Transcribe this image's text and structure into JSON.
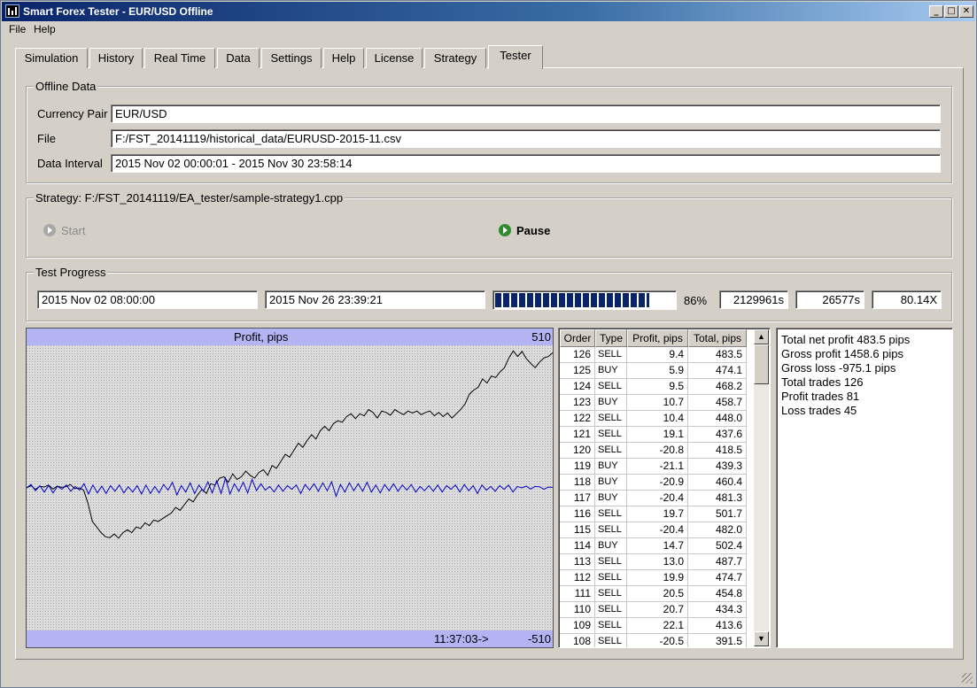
{
  "window": {
    "title": "Smart Forex Tester - EUR/USD Offline"
  },
  "menu": [
    "File",
    "Help"
  ],
  "tabs": [
    "Simulation",
    "History",
    "Real Time",
    "Data",
    "Settings",
    "Help",
    "License",
    "Strategy",
    "Tester"
  ],
  "active_tab": "Tester",
  "offline_data": {
    "legend": "Offline Data",
    "currency_pair_label": "Currency Pair",
    "currency_pair": "EUR/USD",
    "file_label": "File",
    "file": "F:/FST_20141119/historical_data/EURUSD-2015-11.csv",
    "interval_label": "Data Interval",
    "interval": "2015 Nov 02 00:00:01 - 2015 Nov 30 23:58:14"
  },
  "strategy": {
    "legend": "Strategy: F:/FST_20141119/EA_tester/sample-strategy1.cpp",
    "start_label": "Start",
    "pause_label": "Pause"
  },
  "progress": {
    "legend": "Test Progress",
    "from": "2015 Nov 02 08:00:00",
    "current": "2015 Nov 26 23:39:21",
    "percent_value": 0.86,
    "percent_text": "86%",
    "elapsed": "2129961s",
    "remaining": "26577s",
    "speed": "80.14X"
  },
  "chart_data": {
    "type": "line",
    "title": "Profit, pips",
    "y_max_label": "510",
    "y_min_label": "-510",
    "time_label": "11:37:03->",
    "ylim": [
      -510,
      510
    ],
    "series": [
      {
        "color": "#000000",
        "values": [
          0,
          8,
          -5,
          6,
          3,
          10,
          -4,
          6,
          2,
          4,
          12,
          -3,
          0,
          -8,
          -55,
          -120,
          -140,
          -160,
          -175,
          -178,
          -165,
          -180,
          -160,
          -150,
          -160,
          -140,
          -145,
          -125,
          -135,
          -115,
          -120,
          -110,
          -100,
          -90,
          -70,
          -80,
          -60,
          -40,
          -50,
          -25,
          -5,
          -20,
          15,
          10,
          35,
          40,
          20,
          50,
          30,
          40,
          60,
          45,
          35,
          55,
          65,
          45,
          80,
          70,
          95,
          120,
          110,
          135,
          160,
          145,
          170,
          190,
          175,
          205,
          220,
          205,
          230,
          240,
          235,
          255,
          265,
          248,
          265,
          258,
          280,
          270,
          250,
          275,
          270,
          260,
          280,
          270,
          262,
          275,
          268,
          275,
          262,
          270,
          275,
          258,
          270,
          255,
          268,
          250,
          265,
          280,
          300,
          335,
          350,
          360,
          390,
          375,
          400,
          395,
          415,
          430,
          465,
          490,
          470,
          488,
          462,
          445,
          430,
          450,
          465,
          470,
          483.5
        ]
      },
      {
        "color": "#0000cc",
        "values": [
          0,
          12,
          -10,
          8,
          -15,
          9,
          -18,
          6,
          -5,
          10,
          -12,
          5,
          -8,
          15,
          -22,
          10,
          -18,
          6,
          -20,
          8,
          -12,
          10,
          -18,
          4,
          -15,
          8,
          -22,
          10,
          -20,
          5,
          -18,
          12,
          -8,
          20,
          -25,
          8,
          -15,
          18,
          -20,
          10,
          -12,
          22,
          -18,
          25,
          -20,
          35,
          -22,
          15,
          -12,
          20,
          -18,
          30,
          -10,
          15,
          -8,
          5,
          -15,
          10,
          -12,
          8,
          -5,
          10,
          -20,
          12,
          -8,
          15,
          -12,
          18,
          -10,
          22,
          -30,
          12,
          -15,
          18,
          -10,
          15,
          -12,
          20,
          -15,
          10,
          -18,
          12,
          -10,
          15,
          -12,
          10,
          -8,
          12,
          -15,
          5,
          -10,
          8,
          -12,
          10,
          -15,
          8,
          -5,
          10,
          -15,
          12,
          -10,
          8,
          -20,
          10,
          -8,
          5,
          -12,
          8,
          -5,
          10,
          -15,
          5,
          0,
          6,
          -4,
          5,
          4,
          -5,
          3,
          2
        ]
      }
    ]
  },
  "trades": {
    "headers": [
      "Order",
      "Type",
      "Profit, pips",
      "Total, pips"
    ],
    "rows": [
      [
        "126",
        "SELL",
        "9.4",
        "483.5"
      ],
      [
        "125",
        "BUY",
        "5.9",
        "474.1"
      ],
      [
        "124",
        "SELL",
        "9.5",
        "468.2"
      ],
      [
        "123",
        "BUY",
        "10.7",
        "458.7"
      ],
      [
        "122",
        "SELL",
        "10.4",
        "448.0"
      ],
      [
        "121",
        "SELL",
        "19.1",
        "437.6"
      ],
      [
        "120",
        "SELL",
        "-20.8",
        "418.5"
      ],
      [
        "119",
        "BUY",
        "-21.1",
        "439.3"
      ],
      [
        "118",
        "BUY",
        "-20.9",
        "460.4"
      ],
      [
        "117",
        "BUY",
        "-20.4",
        "481.3"
      ],
      [
        "116",
        "SELL",
        "19.7",
        "501.7"
      ],
      [
        "115",
        "SELL",
        "-20.4",
        "482.0"
      ],
      [
        "114",
        "BUY",
        "14.7",
        "502.4"
      ],
      [
        "113",
        "SELL",
        "13.0",
        "487.7"
      ],
      [
        "112",
        "SELL",
        "19.9",
        "474.7"
      ],
      [
        "111",
        "SELL",
        "20.5",
        "454.8"
      ],
      [
        "110",
        "SELL",
        "20.7",
        "434.3"
      ],
      [
        "109",
        "SELL",
        "22.1",
        "413.6"
      ],
      [
        "108",
        "SELL",
        "-20.5",
        "391.5"
      ]
    ]
  },
  "summary": [
    "Total net profit 483.5 pips",
    "Gross profit 1458.6 pips",
    "Gross loss -975.1 pips",
    "Total trades 126",
    "Profit trades 81",
    "Loss trades 45"
  ]
}
